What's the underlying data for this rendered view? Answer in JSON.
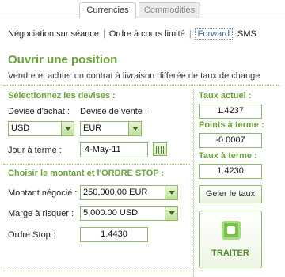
{
  "tabs": [
    {
      "label": "Currencies",
      "active": true
    },
    {
      "label": "Commodities",
      "active": false
    }
  ],
  "subnav": {
    "items": [
      "Négociation sur séance",
      "Ordre à cours limité",
      "Forward",
      "SMS"
    ],
    "active": "Forward",
    "separator": "|"
  },
  "header": {
    "title": "Ouvrir une position",
    "subtitle": "Vendre et achter un contrat à livraison differée de taux de change"
  },
  "currencies": {
    "section_title": "Sélectionnez les devises :",
    "buy_label": "Devise d'achat :",
    "sell_label": "Devise de vente :",
    "buy_value": "USD",
    "sell_value": "EUR",
    "date_label": "Jour à terme :",
    "date_value": "4-May-11"
  },
  "order": {
    "section_title": "Choisir le montant et l'ORDRE STOP :",
    "amount_label": "Montant négocié :",
    "amount_value": "250,000.00 EUR",
    "margin_label": "Marge à risquer :",
    "margin_value": "5,000.00 USD",
    "stop_label": "Ordre Stop :",
    "stop_value": "1.4430"
  },
  "rates": {
    "current_label": "Taux actuel :",
    "current_value": "1.4237",
    "points_label": "Points à terme :",
    "points_value": "-0.0007",
    "forward_label": "Taux à terme :",
    "forward_value": "1.4230",
    "freeze_button": "Geler le taux",
    "trade_button": "TRAITER"
  },
  "colors": {
    "accent_green": "#6aa23a",
    "border_green": "#8fb86a",
    "link_blue": "#3c6a8e"
  }
}
